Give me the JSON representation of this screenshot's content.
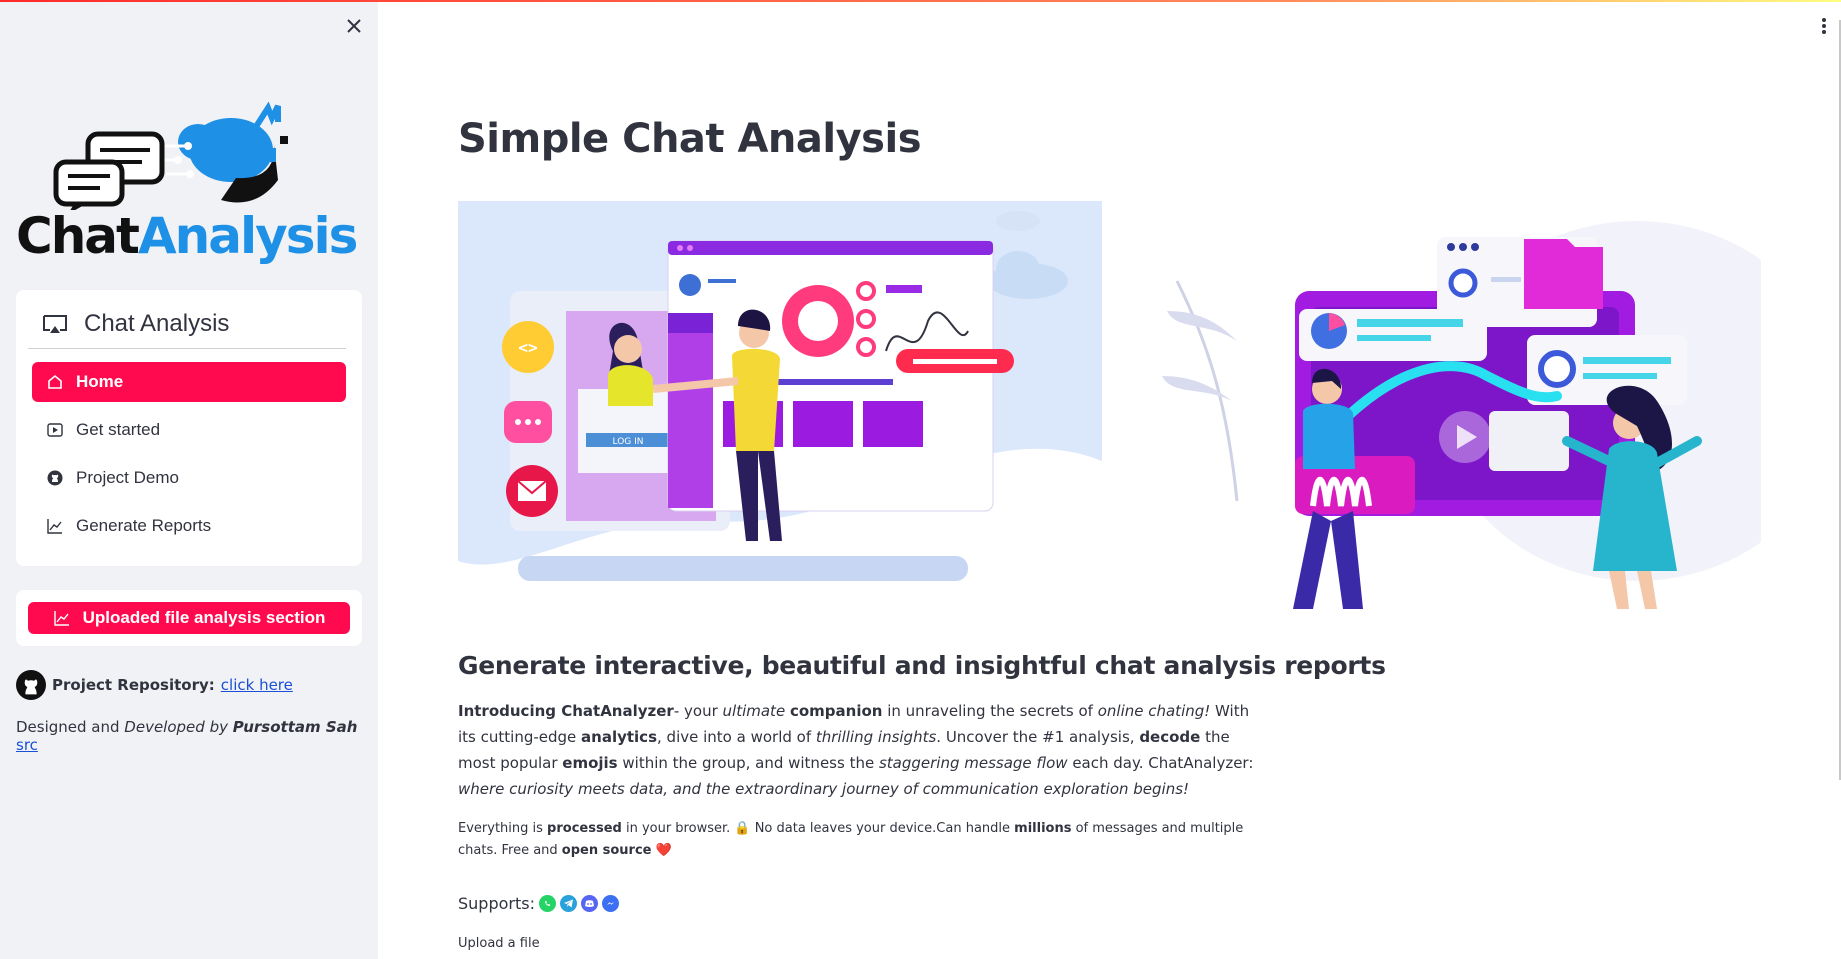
{
  "sidebar": {
    "logo": {
      "part1": "Chat",
      "part2": "Analysis"
    },
    "menu": {
      "title": "Chat Analysis",
      "items": [
        {
          "label": "Home",
          "icon": "house-icon",
          "active": true
        },
        {
          "label": "Get started",
          "icon": "play-icon",
          "active": false
        },
        {
          "label": "Project Demo",
          "icon": "github-icon",
          "active": false
        },
        {
          "label": "Generate Reports",
          "icon": "graph-up-icon",
          "active": false
        }
      ]
    },
    "upload_button": "Uploaded file analysis section",
    "repo": {
      "label": "Project Repository:",
      "link_text": "click here"
    },
    "credit": {
      "pre": "Designed and ",
      "dev": "Developed by",
      "author": "Pursottam Sah",
      "link_text": "src"
    }
  },
  "main": {
    "title": "Simple Chat Analysis",
    "hero_left_login_button": "LOG IN",
    "subtitle": "Generate interactive, beautiful and insightful chat analysis reports",
    "intro": {
      "p1": "Introducing ChatAnalyzer",
      "p2": "- your ",
      "p3": "ultimate",
      "p4": " ",
      "p5": "companion",
      "p6": " in unraveling the secrets of ",
      "p7": "online chating!",
      "p8": " With its cutting-edge ",
      "p9": "analytics",
      "p10": ", dive into a world of ",
      "p11": "thrilling insights",
      "p12": ". Uncover the #1 analysis, ",
      "p13": "decode",
      "p14": " the most popular ",
      "p15": "emojis",
      "p16": " within the group, and witness the ",
      "p17": "staggering message flow",
      "p18": " each day. ChatAnalyzer: ",
      "p19": "where curiosity meets data, and the extraordinary journey of communication exploration begins!"
    },
    "privacy": {
      "p1": "Everything is ",
      "p2": "processed",
      "p3": " in your browser. 🔒 No data leaves your device.Can handle ",
      "p4": "millions",
      "p5": " of messages and multiple chats. Free and ",
      "p6": "open source",
      "p7": " ❤️"
    },
    "supports_label": "Supports:",
    "supports_icons": [
      "whatsapp-icon",
      "telegram-icon",
      "discord-icon",
      "messenger-icon"
    ],
    "upload_label": "Upload a file"
  },
  "colors": {
    "accent": "#ff0a4e",
    "sidebar_bg": "#f0f2f6",
    "link": "#1a4fd6",
    "logo_blue": "#1e90e6"
  }
}
